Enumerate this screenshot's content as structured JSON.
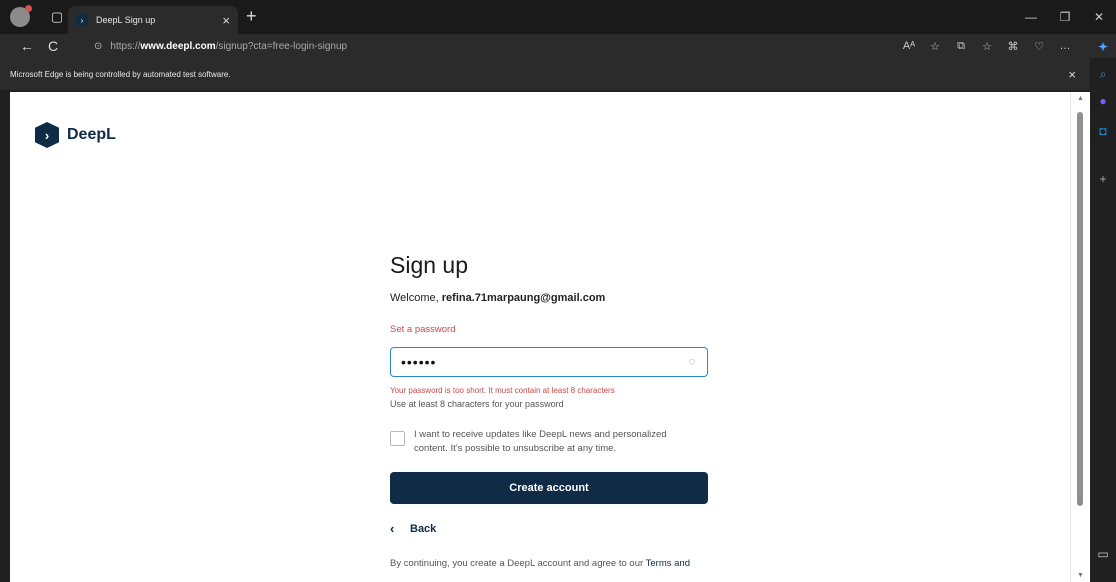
{
  "browser": {
    "tab_title": "DeepL Sign up",
    "url_prefix": "https://",
    "url_host": "www.deepl.com",
    "url_path": "/signup?cta=free-login-signup",
    "infobar": "Microsoft Edge is being controlled by automated test software."
  },
  "icons": {
    "back": "←",
    "refresh": "C",
    "lock": "⊙",
    "reader": "Aᴬ",
    "favorite": "☆",
    "split": "⧉",
    "favorites": "☆",
    "collections": "⌘",
    "health": "♡",
    "more": "…",
    "newtab": "+",
    "close": "×"
  },
  "page": {
    "brand": "DeepL",
    "title": "Sign up",
    "welcome_prefix": "Welcome,",
    "email": "refina.71marpaung@gmail.com",
    "password_label": "Set a password",
    "password_value": "••••••",
    "password_error": "Your password is too short. It must contain at least 8 characters",
    "password_hint": "Use at least 8 characters for your password",
    "checkbox_label": "I want to receive updates like DeepL news and personalized content. It’s possible to unsubscribe at any time.",
    "create_button": "Create account",
    "back_label": "Back",
    "terms_prefix": "By continuing, you create a DeepL account and agree to our",
    "terms_link": "Terms and"
  }
}
